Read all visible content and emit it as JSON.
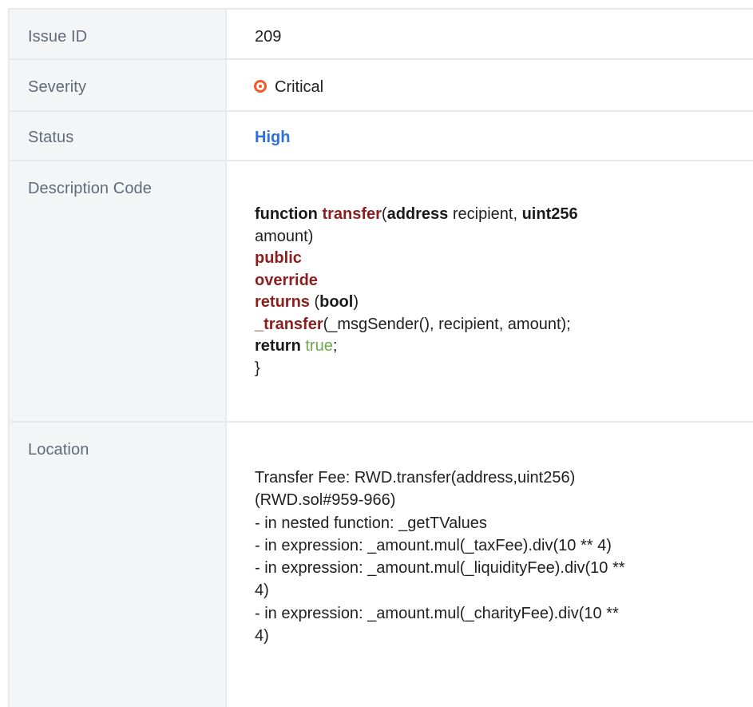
{
  "issue_table": {
    "rows": [
      {
        "label": "Issue ID",
        "value": "209"
      },
      {
        "label": "Severity",
        "value": "Critical",
        "icon": "severity-critical-icon",
        "icon_color": "#f05a28"
      },
      {
        "label": "Status",
        "value": "High",
        "value_color": "#2f6fd6"
      },
      {
        "label": "Description Code"
      },
      {
        "label": "Location"
      }
    ],
    "code": {
      "l1_kw1": "function",
      "l1_fn": "transfer",
      "l1_p1": "(",
      "l1_kw2": "address",
      "l1_t1": " recipient, ",
      "l1_kw3": "uint256",
      "l2": "amount)",
      "l3": "public",
      "l4": "override",
      "l5_kw": "returns",
      "l5_p1": " (",
      "l5_kw2": "bool",
      "l5_p2": ")",
      "l6_fn": "_transfer",
      "l6_rest": "(_msgSender(), recipient, amount);",
      "l7_kw": "return",
      "l7_sp": " ",
      "l7_tv": "true",
      "l7_end": ";",
      "l8": "}"
    },
    "location_lines": [
      "Transfer Fee: RWD.transfer(address,uint256)",
      "(RWD.sol#959-966)",
      "- in nested function: _getTValues",
      "- in expression: _amount.mul(_taxFee).div(10 ** 4)",
      "- in expression: _amount.mul(_liquidityFee).div(10 **",
      "4)",
      "- in expression: _amount.mul(_charityFee).div(10 **",
      "4)"
    ],
    "colors": {
      "label_text": "#5f6c7b",
      "label_bg": "#f4f5f7",
      "keyword_red": "#8b1e1e",
      "true_green": "#6aaa4a",
      "link_blue": "#2f6fd6"
    }
  }
}
